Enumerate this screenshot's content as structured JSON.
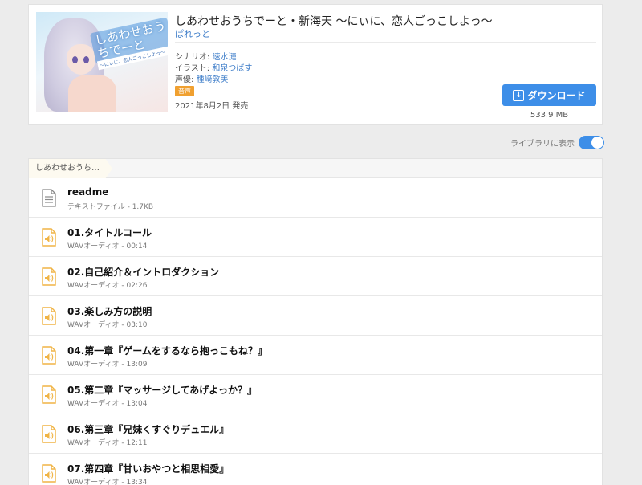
{
  "product": {
    "cover_logo_text": "しあわせおうちでーと",
    "cover_logo_sub": "〜にぃに、恋人ごっこしよっ〜",
    "title": "しあわせおうちでーと・新海天 〜にぃに、恋人ごっこしよっ〜",
    "circle": "ぱれっと",
    "scenario_label": "シナリオ: ",
    "scenario_value": "速水漣",
    "illust_label": "イラスト: ",
    "illust_value": "和泉つばす",
    "voice_label": "声優: ",
    "voice_value": "種﨑敦美",
    "badge": "音声",
    "release": "2021年8月2日 発売",
    "download_label": "ダウンロード",
    "download_icon": "download-icon",
    "size": "533.9 MB"
  },
  "library": {
    "label": "ライブラリに表示",
    "enabled": true
  },
  "breadcrumb": {
    "label": "しあわせおうち…"
  },
  "files": [
    {
      "name": "readme",
      "meta": "テキストファイル - 1.7KB",
      "icon": "text-file-icon"
    },
    {
      "name": "01.タイトルコール",
      "meta": "WAVオーディオ - 00:14",
      "icon": "audio-file-icon"
    },
    {
      "name": "02.自己紹介＆イントロダクション",
      "meta": "WAVオーディオ - 02:26",
      "icon": "audio-file-icon"
    },
    {
      "name": "03.楽しみ方の説明",
      "meta": "WAVオーディオ - 03:10",
      "icon": "audio-file-icon"
    },
    {
      "name": "04.第一章『ゲームをするなら抱っこもね？』",
      "meta": "WAVオーディオ - 13:09",
      "icon": "audio-file-icon"
    },
    {
      "name": "05.第二章『マッサージしてあげよっか？』",
      "meta": "WAVオーディオ - 13:04",
      "icon": "audio-file-icon"
    },
    {
      "name": "06.第三章『兄妹くすぐりデュエル』",
      "meta": "WAVオーディオ - 12:11",
      "icon": "audio-file-icon"
    },
    {
      "name": "07.第四章『甘いおやつと相思相愛』",
      "meta": "WAVオーディオ - 13:34",
      "icon": "audio-file-icon"
    }
  ],
  "colors": {
    "accent": "#3d8ee8",
    "link": "#3b7bc8",
    "badge": "#f0a030",
    "audio_icon": "#f0b445",
    "text_icon": "#8a8a8a"
  }
}
